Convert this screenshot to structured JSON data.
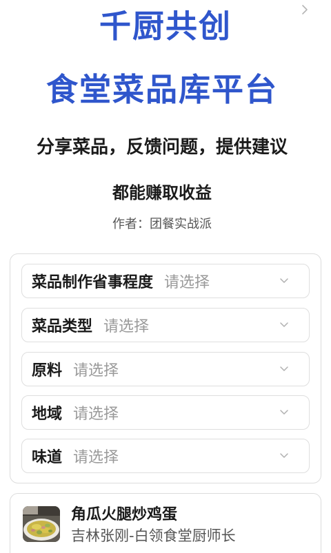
{
  "header": {
    "title_line1": "千厨共创",
    "title_line2": "食堂菜品库平台",
    "slogan_line1": "分享菜品，反馈问题，提供建议",
    "slogan_line2": "都能赚取收益",
    "author": "作者：团餐实战派"
  },
  "filters": [
    {
      "label": "菜品制作省事程度",
      "placeholder": "请选择"
    },
    {
      "label": "菜品类型",
      "placeholder": "请选择"
    },
    {
      "label": "原料",
      "placeholder": "请选择"
    },
    {
      "label": "地域",
      "placeholder": "请选择"
    },
    {
      "label": "味道",
      "placeholder": "请选择"
    }
  ],
  "dish": {
    "name": "角瓜火腿炒鸡蛋",
    "author": "吉林张刚-白领食堂厨师长",
    "thumbnail_icon": "food-photo"
  },
  "colors": {
    "title_blue": "#2f56cc",
    "border_gray": "#dcdcdc",
    "placeholder_gray": "#9a9a9a"
  }
}
